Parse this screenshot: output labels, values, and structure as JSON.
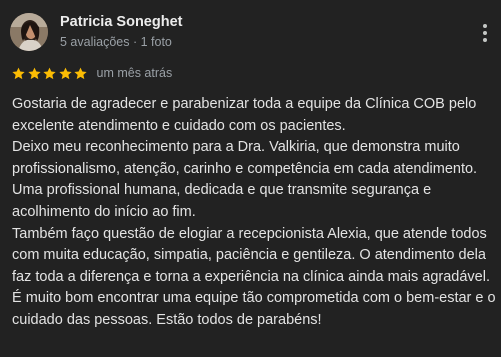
{
  "reviewer": {
    "name": "Patricia Soneghet",
    "meta": "5 avaliações · 1 foto",
    "avatar_icon": "user-avatar-photo"
  },
  "actions": {
    "more_icon": "more-vertical-icon"
  },
  "rating": {
    "stars": 5,
    "max": 5,
    "star_color": "#fbbc04",
    "date": "um mês atrás"
  },
  "review": {
    "paragraphs": [
      "Gostaria de agradecer e parabenizar toda a equipe da Clínica COB pelo excelente atendimento e cuidado com os pacientes.",
      "Deixo meu reconhecimento para a Dra. Valkiria, que demonstra muito profissionalismo, atenção, carinho e competência em cada atendimento. Uma profissional humana, dedicada e que transmite segurança e acolhimento do início ao fim.",
      "Também faço questão de elogiar a recepcionista Alexia, que atende todos com muita educação, simpatia, paciência e gentileza. O atendimento dela faz toda a diferença e torna a experiência na clínica ainda mais agradável.",
      "É muito bom encontrar uma equipe tão comprometida com o bem-estar e o cuidado das pessoas. Estão todos de parabéns!"
    ]
  },
  "colors": {
    "background": "#222222",
    "text": "#e3e3e3",
    "secondary_text": "#9aa0a6",
    "star": "#fbbc04"
  }
}
